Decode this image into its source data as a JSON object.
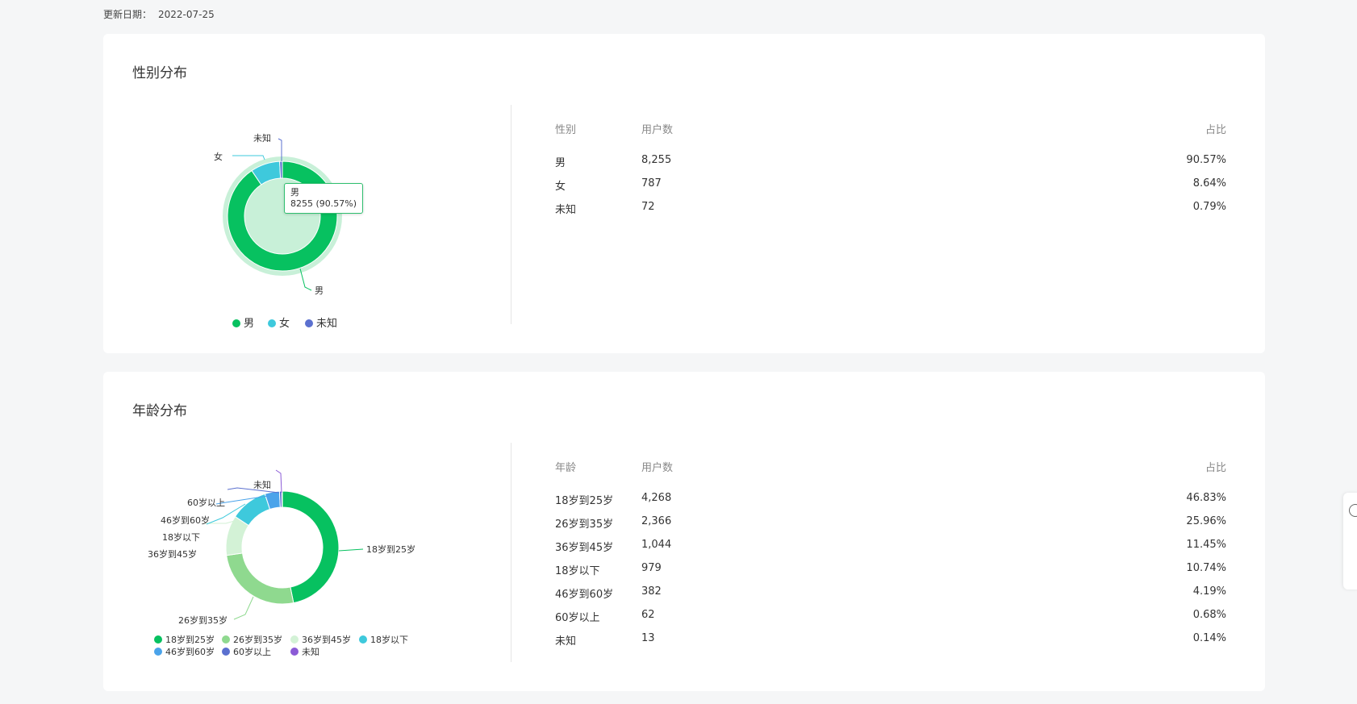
{
  "update": {
    "label": "更新日期：",
    "date": "2022-07-25"
  },
  "gender": {
    "title": "性别分布",
    "table": {
      "headers": [
        "性别",
        "用户数",
        "占比"
      ],
      "rows": [
        [
          "男",
          "8,255",
          "90.57%"
        ],
        [
          "女",
          "787",
          "8.64%"
        ],
        [
          "未知",
          "72",
          "0.79%"
        ]
      ]
    },
    "tooltip": {
      "name": "男",
      "text": "8255 (90.57%)"
    },
    "chart_data": {
      "type": "pie",
      "categories": [
        "男",
        "女",
        "未知"
      ],
      "values": [
        8255,
        787,
        72
      ],
      "colors": [
        "#07c160",
        "#3ec9dc",
        "#5b70cf"
      ],
      "donut": true,
      "legend": "bottom"
    }
  },
  "age": {
    "title": "年龄分布",
    "table": {
      "headers": [
        "年龄",
        "用户数",
        "占比"
      ],
      "rows": [
        [
          "18岁到25岁",
          "4,268",
          "46.83%"
        ],
        [
          "26岁到35岁",
          "2,366",
          "25.96%"
        ],
        [
          "36岁到45岁",
          "1,044",
          "11.45%"
        ],
        [
          "18岁以下",
          "979",
          "10.74%"
        ],
        [
          "46岁到60岁",
          "382",
          "4.19%"
        ],
        [
          "60岁以上",
          "62",
          "0.68%"
        ],
        [
          "未知",
          "13",
          "0.14%"
        ]
      ]
    },
    "chart_data": {
      "type": "pie",
      "categories": [
        "18岁到25岁",
        "26岁到35岁",
        "36岁到45岁",
        "18岁以下",
        "46岁到60岁",
        "60岁以上",
        "未知"
      ],
      "values": [
        4268,
        2366,
        1044,
        979,
        382,
        62,
        13
      ],
      "colors": [
        "#07c160",
        "#8fd98f",
        "#d3f2d6",
        "#3ec9dc",
        "#4aa3ea",
        "#5b70cf",
        "#8b5bd6"
      ],
      "donut": true,
      "legend": "bottom"
    }
  }
}
